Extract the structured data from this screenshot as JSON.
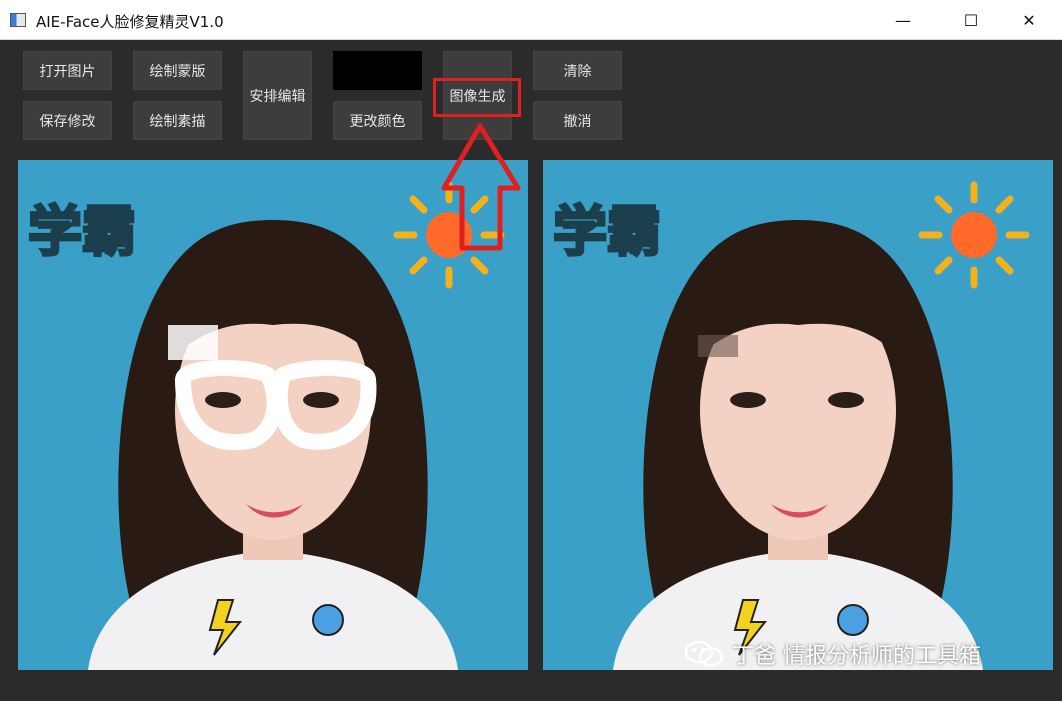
{
  "window": {
    "title": "AIE-Face人脸修复精灵V1.0",
    "minimize_glyph": "—",
    "maximize_glyph": "☐",
    "close_glyph": "✕"
  },
  "toolbar": {
    "open_image": "打开图片",
    "save_changes": "保存修改",
    "draw_mask": "绘制蒙版",
    "draw_sketch": "绘制素描",
    "arrange_edit": "安排编辑",
    "change_color": "更改颜色",
    "generate_image": "图像生成",
    "clear": "清除",
    "undo": "撤消",
    "current_color": "#000000"
  },
  "images": {
    "left_text": "学霸",
    "right_text": "学霸"
  },
  "watermark": {
    "text": "丁爸 情报分析师的工具箱",
    "icon": "wechat-icon"
  },
  "colors": {
    "background": "#2b2b2b",
    "button": "#3d3d3d",
    "highlight": "#e02020",
    "photo_bg": "#3aa0c8",
    "sun": "#ff6a2a",
    "rays": "#f3b21b"
  }
}
